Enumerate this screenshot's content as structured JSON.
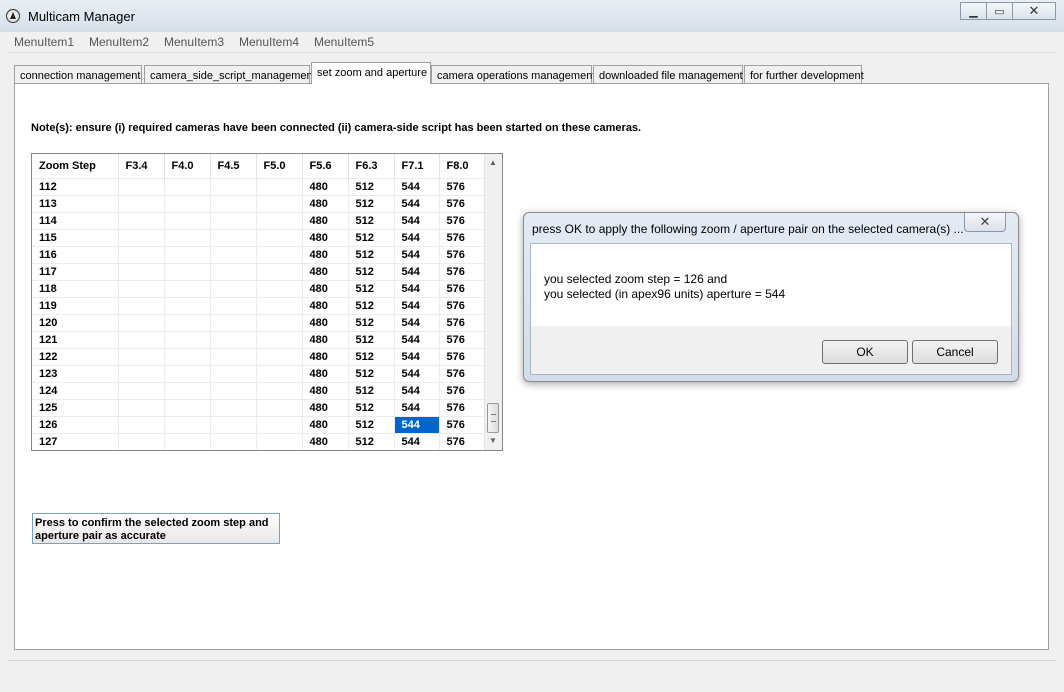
{
  "window": {
    "title": "Multicam Manager",
    "minimize": "▁",
    "maximize": "▭",
    "close": "✕"
  },
  "menu": [
    "MenuItem1",
    "MenuItem2",
    "MenuItem3",
    "MenuItem4",
    "MenuItem5"
  ],
  "tabs": [
    {
      "label": "connection management",
      "active": false
    },
    {
      "label": "camera_side_script_management",
      "active": false
    },
    {
      "label": "set zoom and aperture",
      "active": true
    },
    {
      "label": "camera operations management",
      "active": false
    },
    {
      "label": "downloaded file management",
      "active": false
    },
    {
      "label": "for further development",
      "active": false
    }
  ],
  "note": "Note(s): ensure (i) required cameras have been connected (ii) camera-side script has been started on these cameras.",
  "grid": {
    "columns": [
      "Zoom Step",
      "F3.4",
      "F4.0",
      "F4.5",
      "F5.0",
      "F5.6",
      "F6.3",
      "F7.1",
      "F8.0"
    ],
    "rows": [
      [
        "112",
        "",
        "",
        "",
        "",
        "480",
        "512",
        "544",
        "576"
      ],
      [
        "113",
        "",
        "",
        "",
        "",
        "480",
        "512",
        "544",
        "576"
      ],
      [
        "114",
        "",
        "",
        "",
        "",
        "480",
        "512",
        "544",
        "576"
      ],
      [
        "115",
        "",
        "",
        "",
        "",
        "480",
        "512",
        "544",
        "576"
      ],
      [
        "116",
        "",
        "",
        "",
        "",
        "480",
        "512",
        "544",
        "576"
      ],
      [
        "117",
        "",
        "",
        "",
        "",
        "480",
        "512",
        "544",
        "576"
      ],
      [
        "118",
        "",
        "",
        "",
        "",
        "480",
        "512",
        "544",
        "576"
      ],
      [
        "119",
        "",
        "",
        "",
        "",
        "480",
        "512",
        "544",
        "576"
      ],
      [
        "120",
        "",
        "",
        "",
        "",
        "480",
        "512",
        "544",
        "576"
      ],
      [
        "121",
        "",
        "",
        "",
        "",
        "480",
        "512",
        "544",
        "576"
      ],
      [
        "122",
        "",
        "",
        "",
        "",
        "480",
        "512",
        "544",
        "576"
      ],
      [
        "123",
        "",
        "",
        "",
        "",
        "480",
        "512",
        "544",
        "576"
      ],
      [
        "124",
        "",
        "",
        "",
        "",
        "480",
        "512",
        "544",
        "576"
      ],
      [
        "125",
        "",
        "",
        "",
        "",
        "480",
        "512",
        "544",
        "576"
      ],
      [
        "126",
        "",
        "",
        "",
        "",
        "480",
        "512",
        "544",
        "576"
      ],
      [
        "127",
        "",
        "",
        "",
        "",
        "480",
        "512",
        "544",
        "576"
      ]
    ],
    "selected": {
      "row": 14,
      "col": 7
    },
    "scroll_up": "▲",
    "scroll_down": "▼"
  },
  "confirm_button": "Press to confirm the selected zoom step and aperture pair as accurate",
  "dialog": {
    "title": "press OK to apply the following zoom / aperture pair on the selected camera(s) ...",
    "close": "✕",
    "line1": "you selected zoom step = 126 and",
    "line2": "you selected (in apex96 units) aperture = 544",
    "ok": "OK",
    "cancel": "Cancel"
  }
}
